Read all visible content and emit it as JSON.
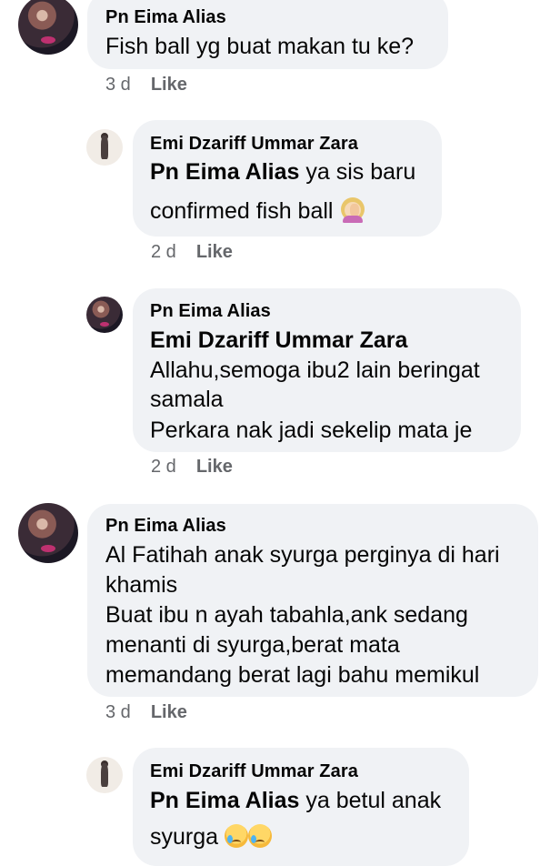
{
  "comments": [
    {
      "author": "Pn Eima Alias",
      "lines": [
        "Fish ball yg buat makan tu ke?"
      ],
      "time": "3 d",
      "like_label": "Like",
      "avatar": "woman-pink-heart-avatar"
    },
    {
      "author": "Emi Dzariff Ummar Zara",
      "mention": "Pn Eima Alias",
      "lines": [
        "ya sis baru",
        "confirmed fish ball"
      ],
      "emoji": "woman-facepalming-emoji",
      "time": "2 d",
      "like_label": "Like",
      "avatar": "child-standing-avatar"
    },
    {
      "author": "Pn Eima Alias",
      "mention": "Emi Dzariff Ummar Zara",
      "lines": [
        "Allahu,semoga ibu2 lain beringat",
        "samala",
        "Perkara nak jadi sekelip mata je"
      ],
      "time": "2 d",
      "like_label": "Like",
      "avatar": "woman-pink-heart-avatar"
    },
    {
      "author": "Pn Eima Alias",
      "lines": [
        "Al Fatihah anak syurga perginya di hari",
        "khamis",
        "Buat ibu n ayah tabahla,ank sedang",
        "menanti di syurga,berat mata",
        "memandang berat lagi bahu memikul"
      ],
      "time": "3 d",
      "like_label": "Like",
      "avatar": "woman-pink-heart-avatar"
    },
    {
      "author": "Emi Dzariff Ummar Zara",
      "mention": "Pn Eima Alias",
      "lines": [
        "ya betul anak",
        "syurga"
      ],
      "emoji": "crying-face-emoji",
      "avatar": "child-standing-avatar"
    }
  ]
}
